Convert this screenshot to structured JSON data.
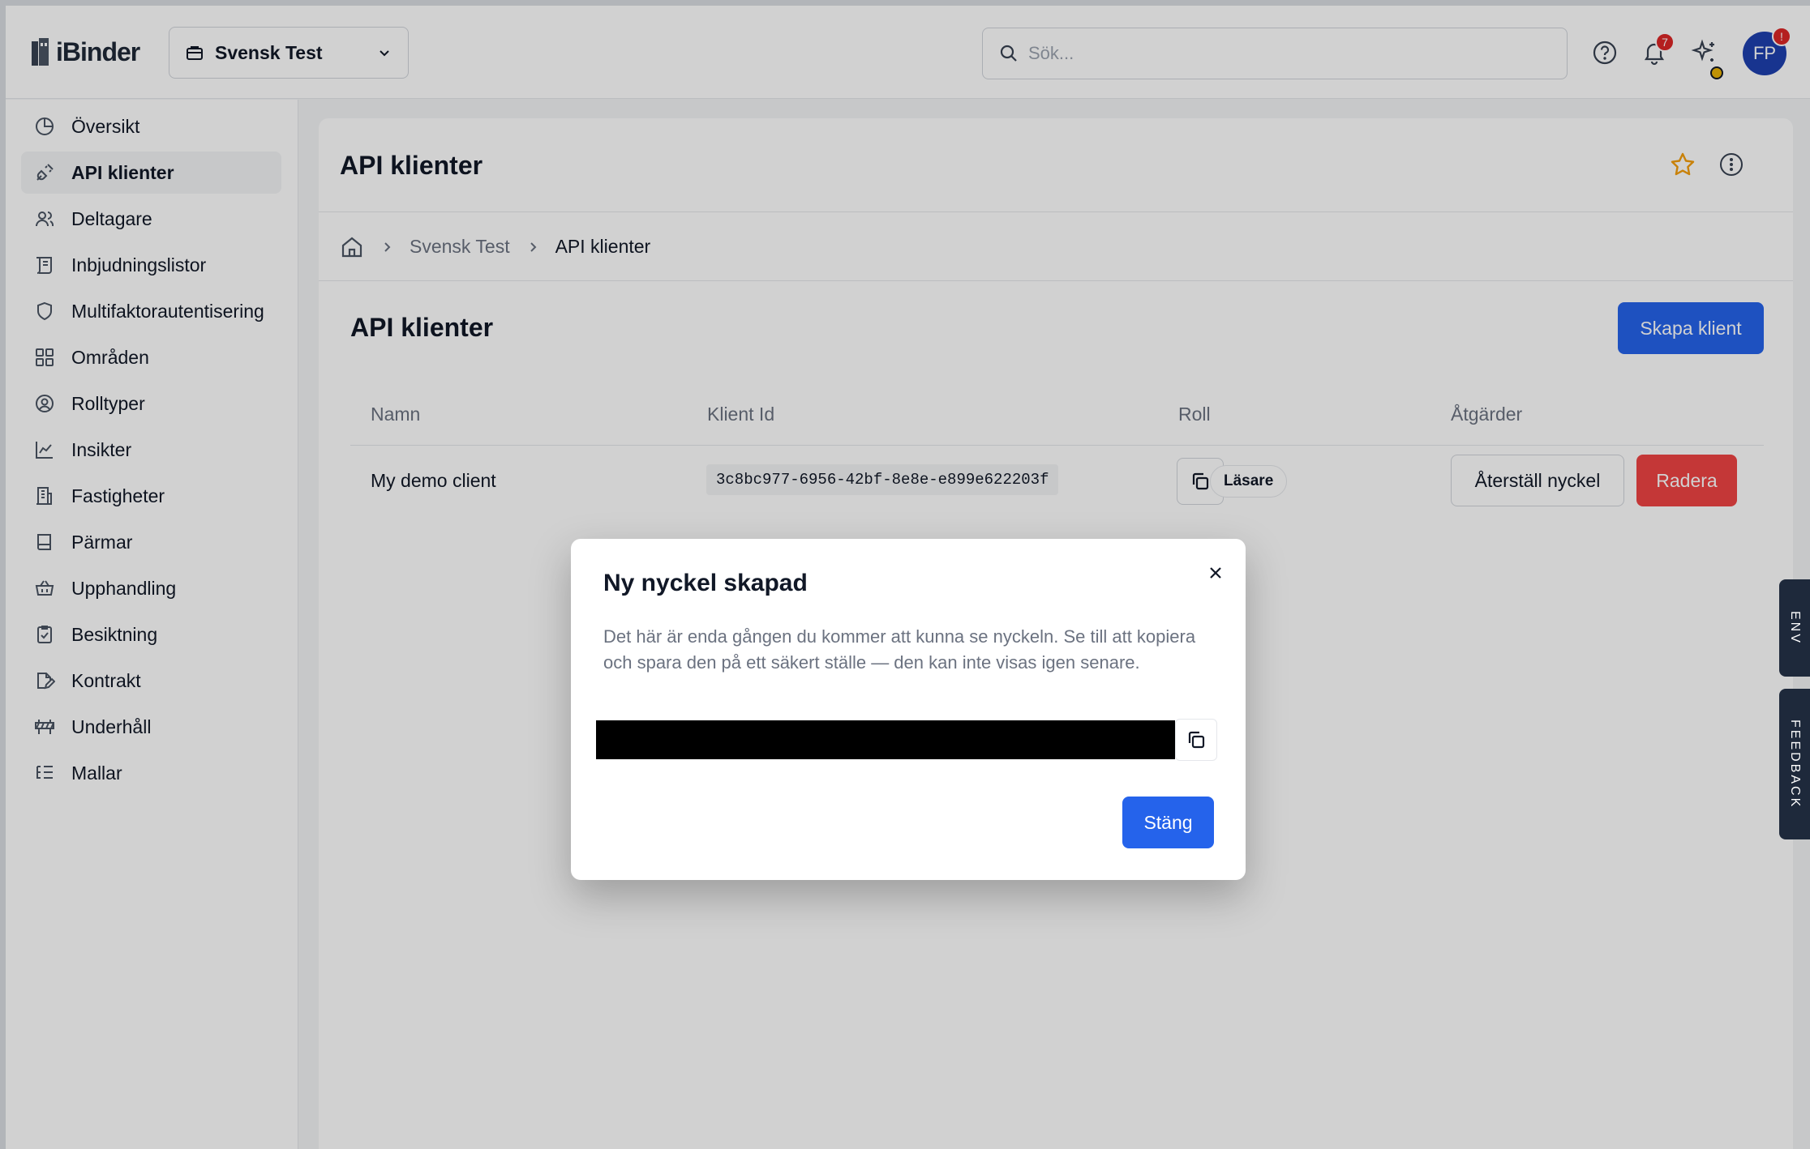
{
  "app": {
    "logo_text": "iBinder"
  },
  "header": {
    "org_name": "Svensk Test",
    "search_placeholder": "Sök...",
    "notification_count": "7",
    "avatar_initials": "FP",
    "avatar_alert": "!"
  },
  "sidebar": {
    "items": [
      {
        "label": "Översikt",
        "icon": "pie-chart-icon"
      },
      {
        "label": "API klienter",
        "icon": "plug-icon",
        "active": true
      },
      {
        "label": "Deltagare",
        "icon": "users-icon"
      },
      {
        "label": "Inbjudningslistor",
        "icon": "scroll-icon"
      },
      {
        "label": "Multifaktorautentisering",
        "icon": "shield-icon"
      },
      {
        "label": "Områden",
        "icon": "grid-icon"
      },
      {
        "label": "Rolltyper",
        "icon": "user-circle-icon"
      },
      {
        "label": "Insikter",
        "icon": "line-chart-icon"
      },
      {
        "label": "Fastigheter",
        "icon": "building-icon"
      },
      {
        "label": "Pärmar",
        "icon": "book-icon"
      },
      {
        "label": "Upphandling",
        "icon": "basket-icon"
      },
      {
        "label": "Besiktning",
        "icon": "clipboard-check-icon"
      },
      {
        "label": "Kontrakt",
        "icon": "file-edit-icon"
      },
      {
        "label": "Underhåll",
        "icon": "barrier-icon"
      },
      {
        "label": "Mallar",
        "icon": "list-tree-icon"
      }
    ]
  },
  "page": {
    "title": "API klienter",
    "breadcrumb": [
      "Svensk Test",
      "API klienter"
    ],
    "section_title": "API klienter",
    "create_button": "Skapa klient"
  },
  "table": {
    "columns": [
      "Namn",
      "Klient Id",
      "Roll",
      "Åtgärder"
    ],
    "rows": [
      {
        "name": "My demo client",
        "client_id": "3c8bc977-6956-42bf-8e8e-e899e622203f",
        "role": "Läsare",
        "reset_label": "Återställ nyckel",
        "delete_label": "Radera"
      }
    ]
  },
  "side_tabs": {
    "env": "ENV",
    "feedback": "FEEDBACK"
  },
  "modal": {
    "title": "Ny nyckel skapad",
    "text": "Det här är enda gången du kommer att kunna se nyckeln. Se till att kopiera och spara den på ett säkert ställe — den kan inte visas igen senare.",
    "close_button": "Stäng"
  },
  "colors": {
    "primary": "#2563eb",
    "danger": "#ef4444",
    "avatar": "#1e40af",
    "star": "#f59e0b",
    "side_tab": "#1e293b"
  }
}
